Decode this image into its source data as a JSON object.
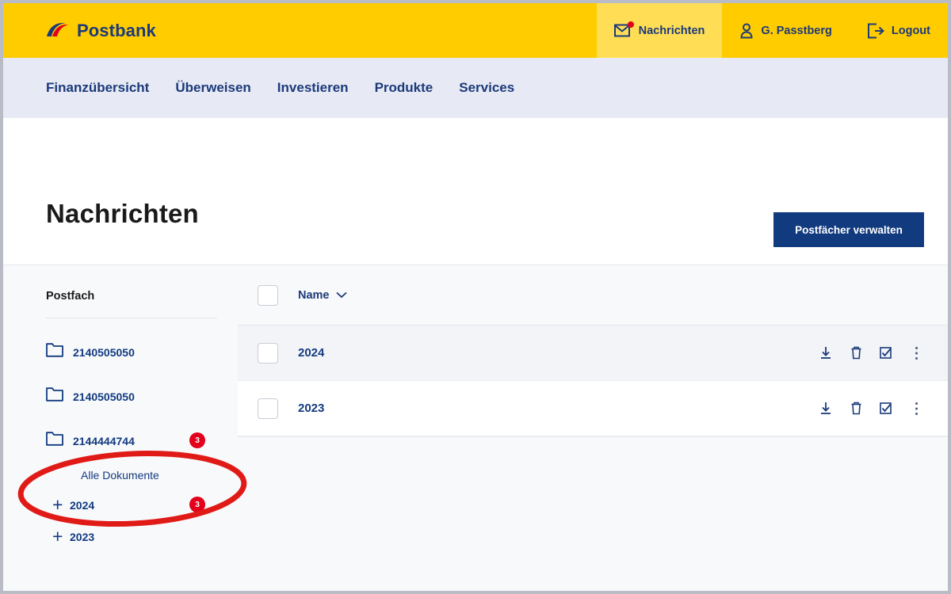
{
  "brand": {
    "name": "Postbank",
    "logo_icon": "postbank-logo-icon",
    "colors": {
      "yellow": "#ffcc00",
      "yellow_active": "#ffdd55",
      "navy": "#1b3a7a",
      "button_navy": "#123a7f",
      "red": "#e2001a",
      "nav_background": "#e7e9f4"
    }
  },
  "topbar": {
    "items": [
      {
        "label": "Nachrichten",
        "icon": "envelope-icon",
        "active": true,
        "has_notification_dot": true
      },
      {
        "label": "G. Passtberg",
        "icon": "user-icon",
        "active": false,
        "has_notification_dot": false
      },
      {
        "label": "Logout",
        "icon": "logout-icon",
        "active": false,
        "has_notification_dot": false
      }
    ]
  },
  "mainnav": {
    "items": [
      {
        "label": "Finanzübersicht"
      },
      {
        "label": "Überweisen"
      },
      {
        "label": "Investieren"
      },
      {
        "label": "Produkte"
      },
      {
        "label": "Services"
      }
    ]
  },
  "page": {
    "title": "Nachrichten",
    "primary_button": "Postfächer verwalten"
  },
  "sidebar": {
    "heading": "Postfach",
    "folders": [
      {
        "label": "2140505050",
        "icon": "folder-icon",
        "badge": null
      },
      {
        "label": "2140505050",
        "icon": "folder-icon",
        "badge": null
      },
      {
        "label": "2144444744",
        "icon": "folder-icon",
        "badge": "3"
      }
    ],
    "subitems": [
      {
        "label": "Alle Dokumente",
        "expand_icon": null,
        "badge": null
      },
      {
        "label": "2024",
        "expand_icon": "plus-icon",
        "badge": "3"
      },
      {
        "label": "2023",
        "expand_icon": "plus-icon",
        "badge": null
      }
    ]
  },
  "table": {
    "header": {
      "select_all_checkbox": false,
      "columns": [
        {
          "label": "Name",
          "sort_icon": "chevron-down-icon"
        }
      ]
    },
    "row_actions": [
      {
        "icon": "download-icon",
        "name": "download-action"
      },
      {
        "icon": "trash-icon",
        "name": "delete-action"
      },
      {
        "icon": "check-box-icon",
        "name": "mark-read-action"
      },
      {
        "icon": "more-vertical-icon",
        "name": "more-actions"
      }
    ],
    "rows": [
      {
        "name": "2024",
        "checked": false,
        "highlighted": true
      },
      {
        "name": "2023",
        "checked": false,
        "highlighted": false
      }
    ]
  },
  "annotation": {
    "shape": "ellipse",
    "color": "#e01b17",
    "stroke_width": 7,
    "encircles": [
      "Alle Dokumente",
      "2024"
    ]
  }
}
